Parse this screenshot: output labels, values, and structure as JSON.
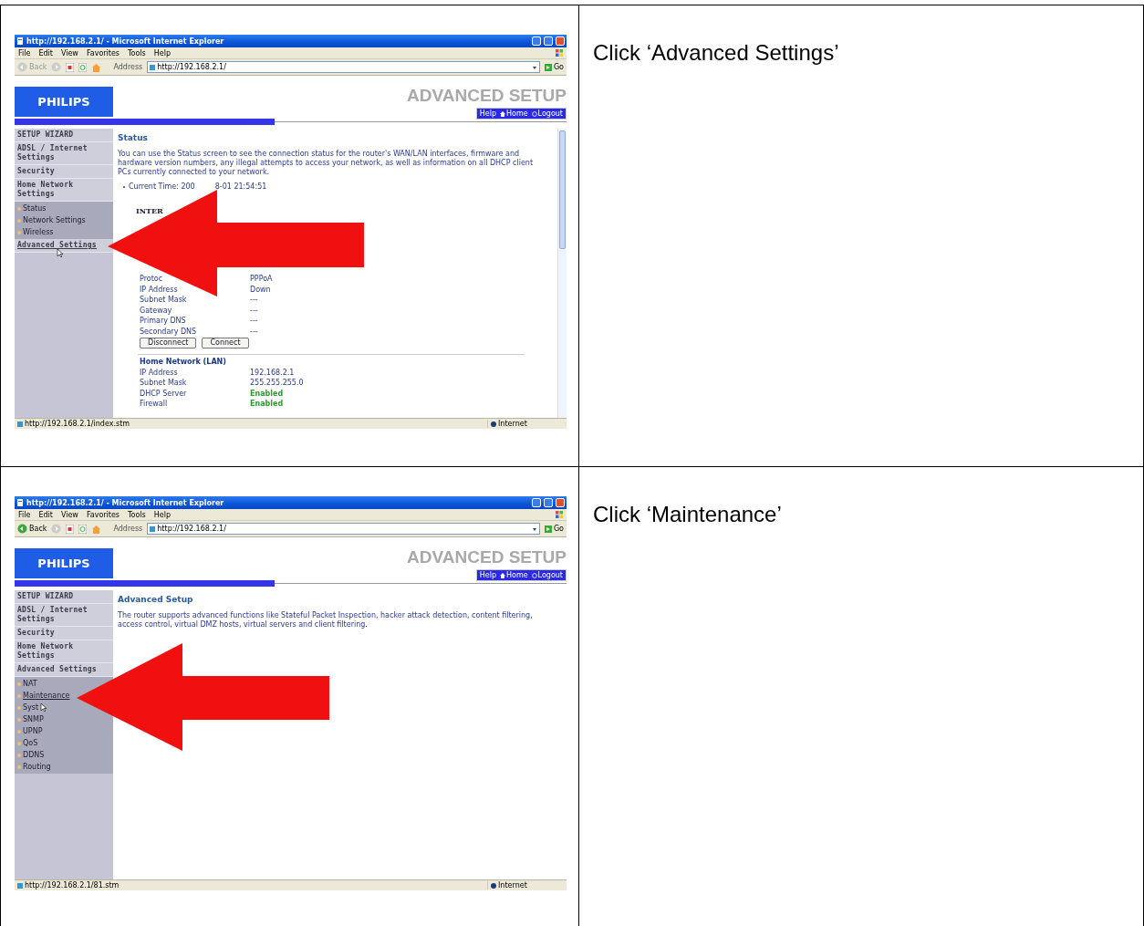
{
  "steps": [
    {
      "instruction": "Click ‘Advanced Settings’",
      "browser": {
        "title": "http://192.168.2.1/ - Microsoft Internet Explorer",
        "menu": [
          "File",
          "Edit",
          "View",
          "Favorites",
          "Tools",
          "Help"
        ],
        "back": "Back",
        "back_enabled": false,
        "address_label": "Address",
        "address": "http://192.168.2.1/",
        "go": "Go",
        "status_url": "http://192.168.2.1/index.stm",
        "zone": "Internet"
      },
      "router": {
        "logo": "PHILIPS",
        "heading": "ADVANCED SETUP",
        "nav": [
          "Help",
          "Home",
          "Logout"
        ],
        "sidebar": [
          {
            "label": "SETUP WIZARD",
            "hovered": false,
            "cursor": false
          },
          {
            "label": "ADSL / Internet Settings",
            "hovered": false,
            "cursor": false
          },
          {
            "label": "Security",
            "hovered": false,
            "cursor": false
          },
          {
            "label": "Home Network Settings",
            "hovered": false,
            "cursor": false,
            "children": [
              {
                "label": "Status",
                "hovered": false,
                "cursor": false
              },
              {
                "label": "Network Settings",
                "hovered": false,
                "cursor": false
              },
              {
                "label": "Wireless",
                "hovered": false,
                "cursor": false
              }
            ]
          },
          {
            "label": "Advanced Settings",
            "hovered": true,
            "cursor": true
          }
        ],
        "content": {
          "title": "Status",
          "intro": "You can use the Status screen to see the connection status for the router's WAN/LAN interfaces, firmware and hardware version numbers, any illegal attempts to access your network, as well as information on all DHCP client PCs currently connected to your network.",
          "bullet_parts": [
            "Current Time: 200",
            "8-01 21:54:51"
          ],
          "section": "INTER",
          "rows": [
            {
              "label": "Protoc",
              "value": "PPPoA"
            },
            {
              "label": "IP Address",
              "value": "Down"
            },
            {
              "label": "Subnet Mask",
              "value": "---"
            },
            {
              "label": "Gateway",
              "value": "---"
            },
            {
              "label": "Primary DNS",
              "value": "---"
            },
            {
              "label": "Secondary DNS",
              "value": "---"
            }
          ],
          "buttons": [
            "Disconnect",
            "Connect"
          ],
          "lan": {
            "title": "Home Network (LAN)",
            "rows": [
              {
                "label": "IP Address",
                "value": "192.168.2.1"
              },
              {
                "label": "Subnet Mask",
                "value": "255.255.255.0"
              },
              {
                "label": "DHCP Server",
                "value": "Enabled",
                "color": "#2e9a2e"
              },
              {
                "label": "Firewall",
                "value": "Enabled",
                "color": "#2e9a2e"
              }
            ]
          }
        }
      }
    },
    {
      "instruction": "Click ‘Maintenance’",
      "browser": {
        "title": "http://192.168.2.1/ - Microsoft Internet Explorer",
        "menu": [
          "File",
          "Edit",
          "View",
          "Favorites",
          "Tools",
          "Help"
        ],
        "back": "Back",
        "back_enabled": true,
        "address_label": "Address",
        "address": "http://192.168.2.1/",
        "go": "Go",
        "status_url": "http://192.168.2.1/81.stm",
        "zone": "Internet"
      },
      "router": {
        "logo": "PHILIPS",
        "heading": "ADVANCED SETUP",
        "nav": [
          "Help",
          "Home",
          "Logout"
        ],
        "sidebar": [
          {
            "label": "SETUP WIZARD",
            "hovered": false,
            "cursor": false
          },
          {
            "label": "ADSL / Internet Settings",
            "hovered": false,
            "cursor": false
          },
          {
            "label": "Security",
            "hovered": false,
            "cursor": false
          },
          {
            "label": "Home Network Settings",
            "hovered": false,
            "cursor": false
          },
          {
            "label": "Advanced Settings",
            "hovered": false,
            "cursor": false,
            "children": [
              {
                "label": "NAT",
                "hovered": false,
                "cursor": false
              },
              {
                "label": "Maintenance",
                "hovered": true,
                "cursor": false
              },
              {
                "label": "Syst",
                "hovered": false,
                "cursor": true
              },
              {
                "label": "SNMP",
                "hovered": false,
                "cursor": false
              },
              {
                "label": "UPNP",
                "hovered": false,
                "cursor": false
              },
              {
                "label": "QoS",
                "hovered": false,
                "cursor": false
              },
              {
                "label": "DDNS",
                "hovered": false,
                "cursor": false
              },
              {
                "label": "Routing",
                "hovered": false,
                "cursor": false
              }
            ]
          }
        ],
        "content": {
          "title": "Advanced Setup",
          "intro": "The router supports advanced functions like Stateful Packet Inspection, hacker attack detection, content filtering, access control, virtual DMZ hosts, virtual servers and client filtering."
        }
      }
    }
  ]
}
